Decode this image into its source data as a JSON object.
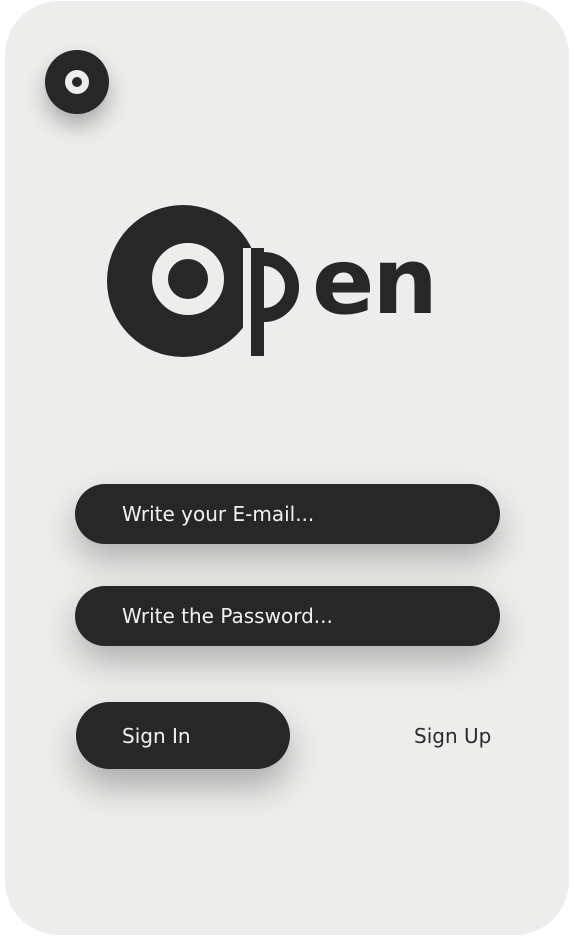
{
  "brand": {
    "logo_text": "open",
    "corner_logo_icon": "ring-logo-icon"
  },
  "form": {
    "email_placeholder": "Write your E-mail...",
    "password_placeholder": "Write the Password..."
  },
  "actions": {
    "sign_in_label": "Sign In",
    "sign_up_label": "Sign Up"
  },
  "colors": {
    "background": "#ededeb",
    "dark": "#272727",
    "light_text": "#f1f1f1"
  }
}
